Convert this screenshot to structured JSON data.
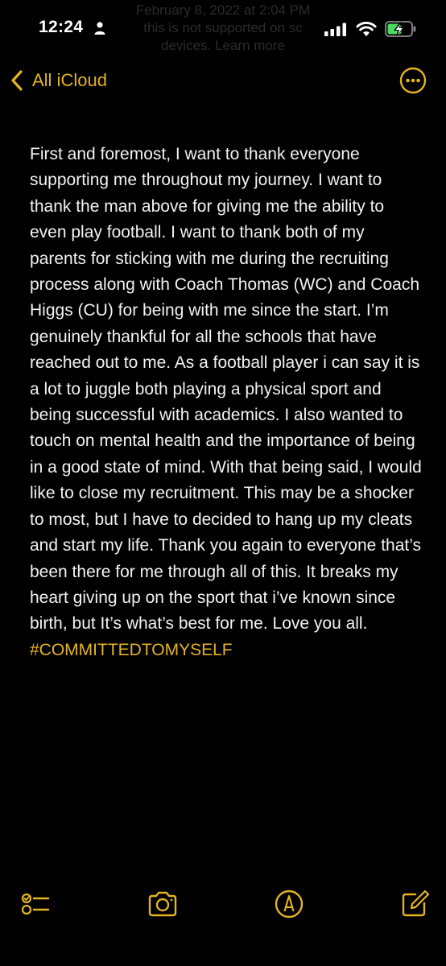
{
  "status_bar": {
    "time": "12:24",
    "ghost_lines": [
      "February 8, 2022 at 2:04 PM",
      "this is not supported on sc",
      "devices. Learn more"
    ]
  },
  "nav": {
    "back_label": "All iCloud",
    "back_icon": "chevron-left-icon",
    "more_icon": "ellipsis-circle-icon"
  },
  "note": {
    "body_text": "First and foremost, I want to thank everyone supporting me throughout my journey. I want to thank the man above for giving me the ability to even play football. I want to thank both of my parents for sticking with me during the recruiting process along with Coach Thomas (WC) and Coach Higgs (CU) for being with me since the start. I’m genuinely thankful for all the schools that have reached out to me. As a football player i can say it is a lot to juggle both playing a physical sport and being successful with academics. I also wanted to touch on mental health and the importance of being in a good state of mind. With that being said, I would like to close my recruitment. This may be a shocker to most, but I have to decided to hang up my cleats and start my life. Thank you again to everyone that’s been there for me through all of this. It breaks my heart giving up on the sport that i’ve known since birth, but It’s what’s best for me. Love you all.",
    "hashtag": "#COMMITTEDTOMYSELF"
  },
  "toolbar": {
    "items": [
      "checklist-icon",
      "camera-icon",
      "markup-icon",
      "compose-icon"
    ]
  },
  "colors": {
    "accent": "#e4b320",
    "background": "#000000",
    "text": "#f2f2f2"
  }
}
